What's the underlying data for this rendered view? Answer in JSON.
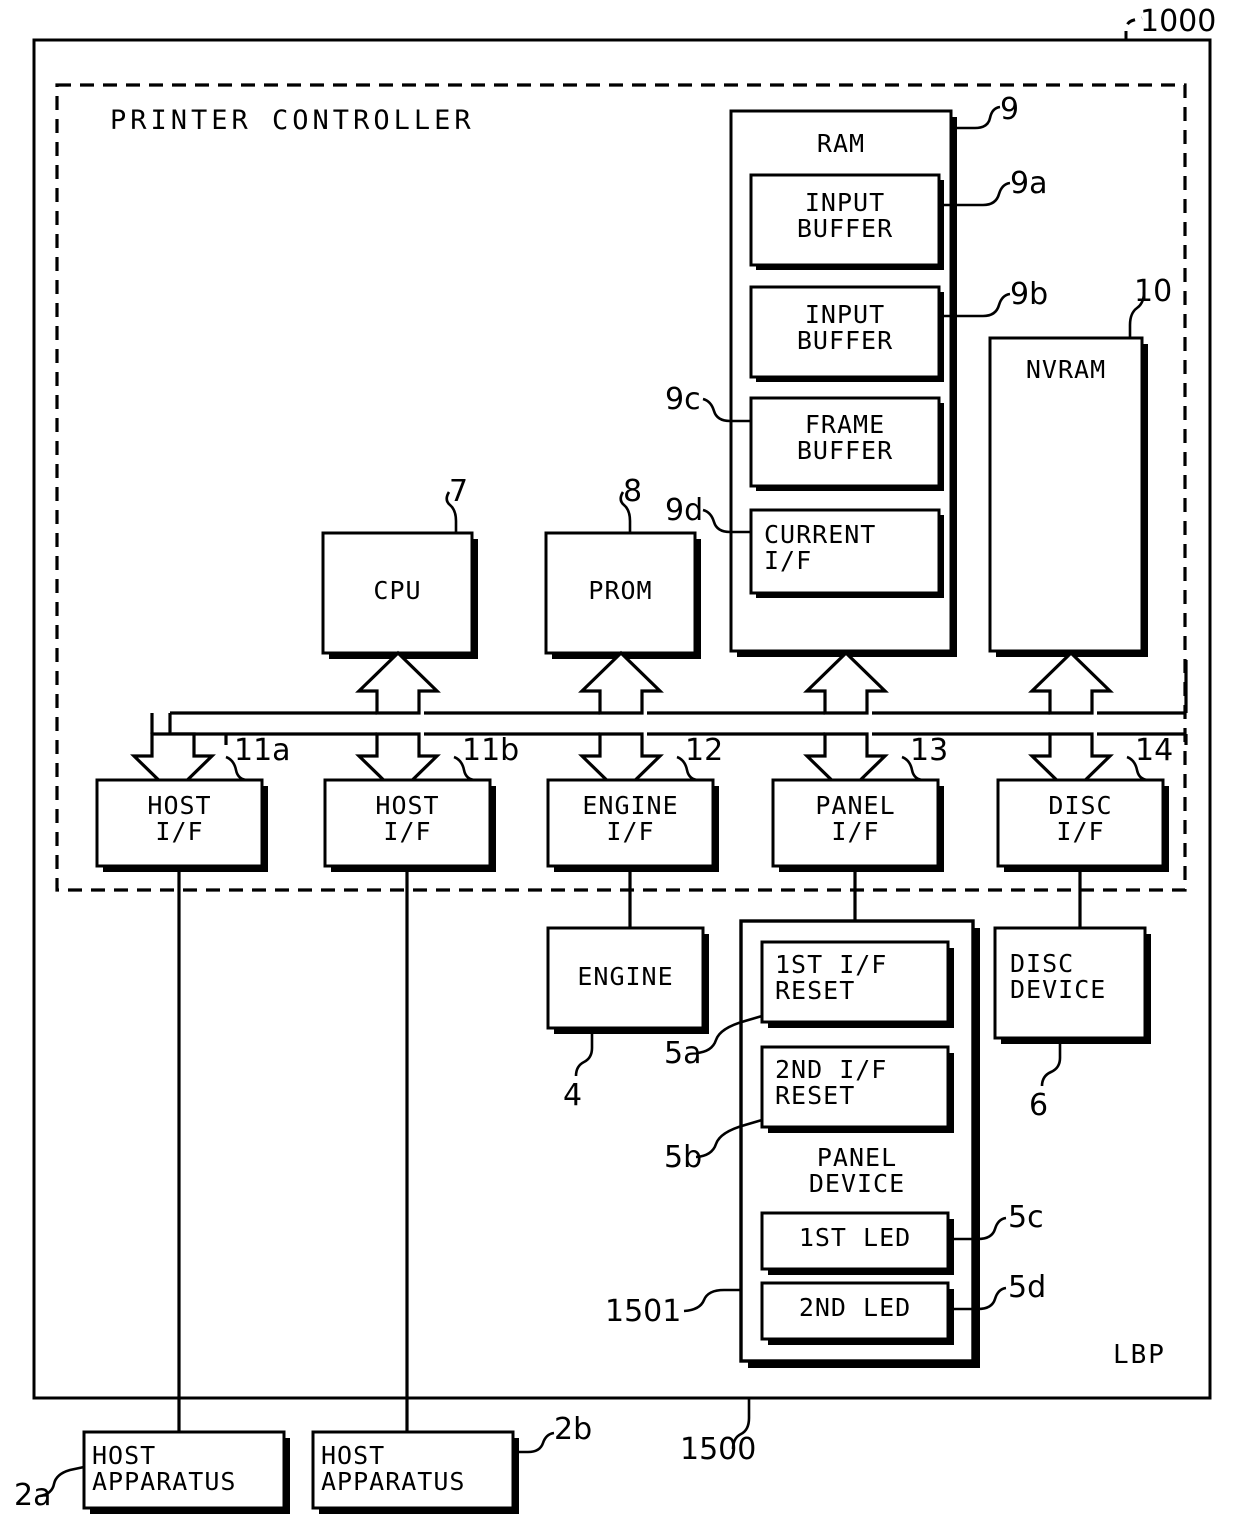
{
  "figure": {
    "title": "PRINTER CONTROLLER",
    "outer_label": "LBP",
    "outer_ref": "1000",
    "device_ref": "1500"
  },
  "blocks": {
    "ram": {
      "label": "RAM",
      "ref": "9"
    },
    "input_buffer_1": {
      "label": "INPUT\nBUFFER",
      "ref": "9a"
    },
    "input_buffer_2": {
      "label": "INPUT\nBUFFER",
      "ref": "9b"
    },
    "frame_buffer": {
      "label": "FRAME\nBUFFER",
      "ref": "9c"
    },
    "current_if": {
      "label": "CURRENT\nI/F",
      "ref": "9d"
    },
    "nvram": {
      "label": "NVRAM",
      "ref": "10"
    },
    "cpu": {
      "label": "CPU",
      "ref": "7"
    },
    "prom": {
      "label": "PROM",
      "ref": "8"
    },
    "host_if_1": {
      "label": "HOST\nI/F",
      "ref": "11a"
    },
    "host_if_2": {
      "label": "HOST\nI/F",
      "ref": "11b"
    },
    "engine_if": {
      "label": "ENGINE\nI/F",
      "ref": "12"
    },
    "panel_if": {
      "label": "PANEL\nI/F",
      "ref": "13"
    },
    "disc_if": {
      "label": "DISC\nI/F",
      "ref": "14"
    },
    "engine": {
      "label": "ENGINE",
      "ref": "4"
    },
    "disc_device": {
      "label": "DISC\nDEVICE",
      "ref": "6"
    },
    "panel_device": {
      "label": "PANEL\nDEVICE",
      "ref": "1501"
    },
    "first_if_reset": {
      "label": "1ST I/F\nRESET",
      "ref": "5a"
    },
    "second_if_reset": {
      "label": "2ND I/F\nRESET",
      "ref": "5b"
    },
    "first_led": {
      "label": "1ST LED",
      "ref": "5c"
    },
    "second_led": {
      "label": "2ND LED",
      "ref": "5d"
    },
    "host_apparatus_1": {
      "label": "HOST\nAPPARATUS",
      "ref": "2a"
    },
    "host_apparatus_2": {
      "label": "HOST\nAPPARATUS",
      "ref": "2b"
    }
  },
  "colors": {
    "line": "#000000",
    "background": "#ffffff"
  }
}
